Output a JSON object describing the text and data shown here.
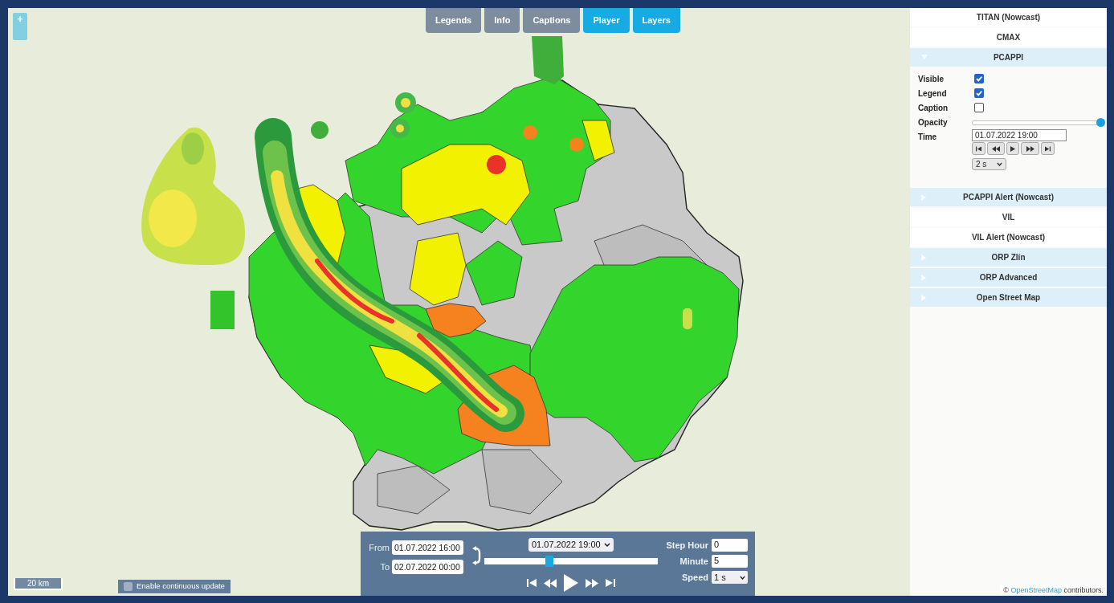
{
  "zoom_control": {
    "label": "+"
  },
  "toolbar": [
    {
      "label": "Legends",
      "active": false
    },
    {
      "label": "Info",
      "active": false
    },
    {
      "label": "Captions",
      "active": false
    },
    {
      "label": "Player",
      "active": true
    },
    {
      "label": "Layers",
      "active": true
    }
  ],
  "layers_panel": {
    "layers": [
      {
        "name": "TITAN (Nowcast)",
        "active": false
      },
      {
        "name": "CMAX",
        "active": false
      },
      {
        "name": "PCAPPI",
        "active": true,
        "expanded": true,
        "settings": {
          "checkboxes": [
            {
              "label": "Visible",
              "checked": true
            },
            {
              "label": "Legend",
              "checked": true
            },
            {
              "label": "Caption",
              "checked": false
            }
          ],
          "opacity": {
            "label": "Opacity",
            "level": 1
          },
          "time": {
            "label": "Time",
            "value": "01.07.2022 19:00"
          },
          "speed": "2 s"
        }
      },
      {
        "name": "PCAPPI Alert (Nowcast)",
        "active": true,
        "expanded": false
      },
      {
        "name": "VIL",
        "active": false
      },
      {
        "name": "VIL Alert (Nowcast)",
        "active": false
      },
      {
        "name": "ORP Zlín",
        "active": true,
        "expanded": false
      },
      {
        "name": "ORP Advanced",
        "active": true,
        "expanded": false
      },
      {
        "name": "Open Street Map",
        "active": true,
        "expanded": false
      }
    ]
  },
  "player": {
    "from": {
      "label": "From",
      "value": "01.07.2022 16:00"
    },
    "to": {
      "label": "To",
      "value": "02.07.2022 00:00"
    },
    "current_time": "01.07.2022 19:00",
    "timeline": {
      "level": 0.37
    },
    "step_hour": {
      "label": "Step Hour",
      "value": "0"
    },
    "minute": {
      "label": "Minute",
      "value": "5"
    },
    "speed": {
      "label": "Speed",
      "value": "1 s"
    }
  },
  "scale_bar": {
    "label": "20 km"
  },
  "continuous_update": {
    "label": "Enable continuous update",
    "checked": false
  },
  "attribution": {
    "prefix": "©",
    "link": "OpenStreetMap",
    "suffix": "contributors."
  }
}
